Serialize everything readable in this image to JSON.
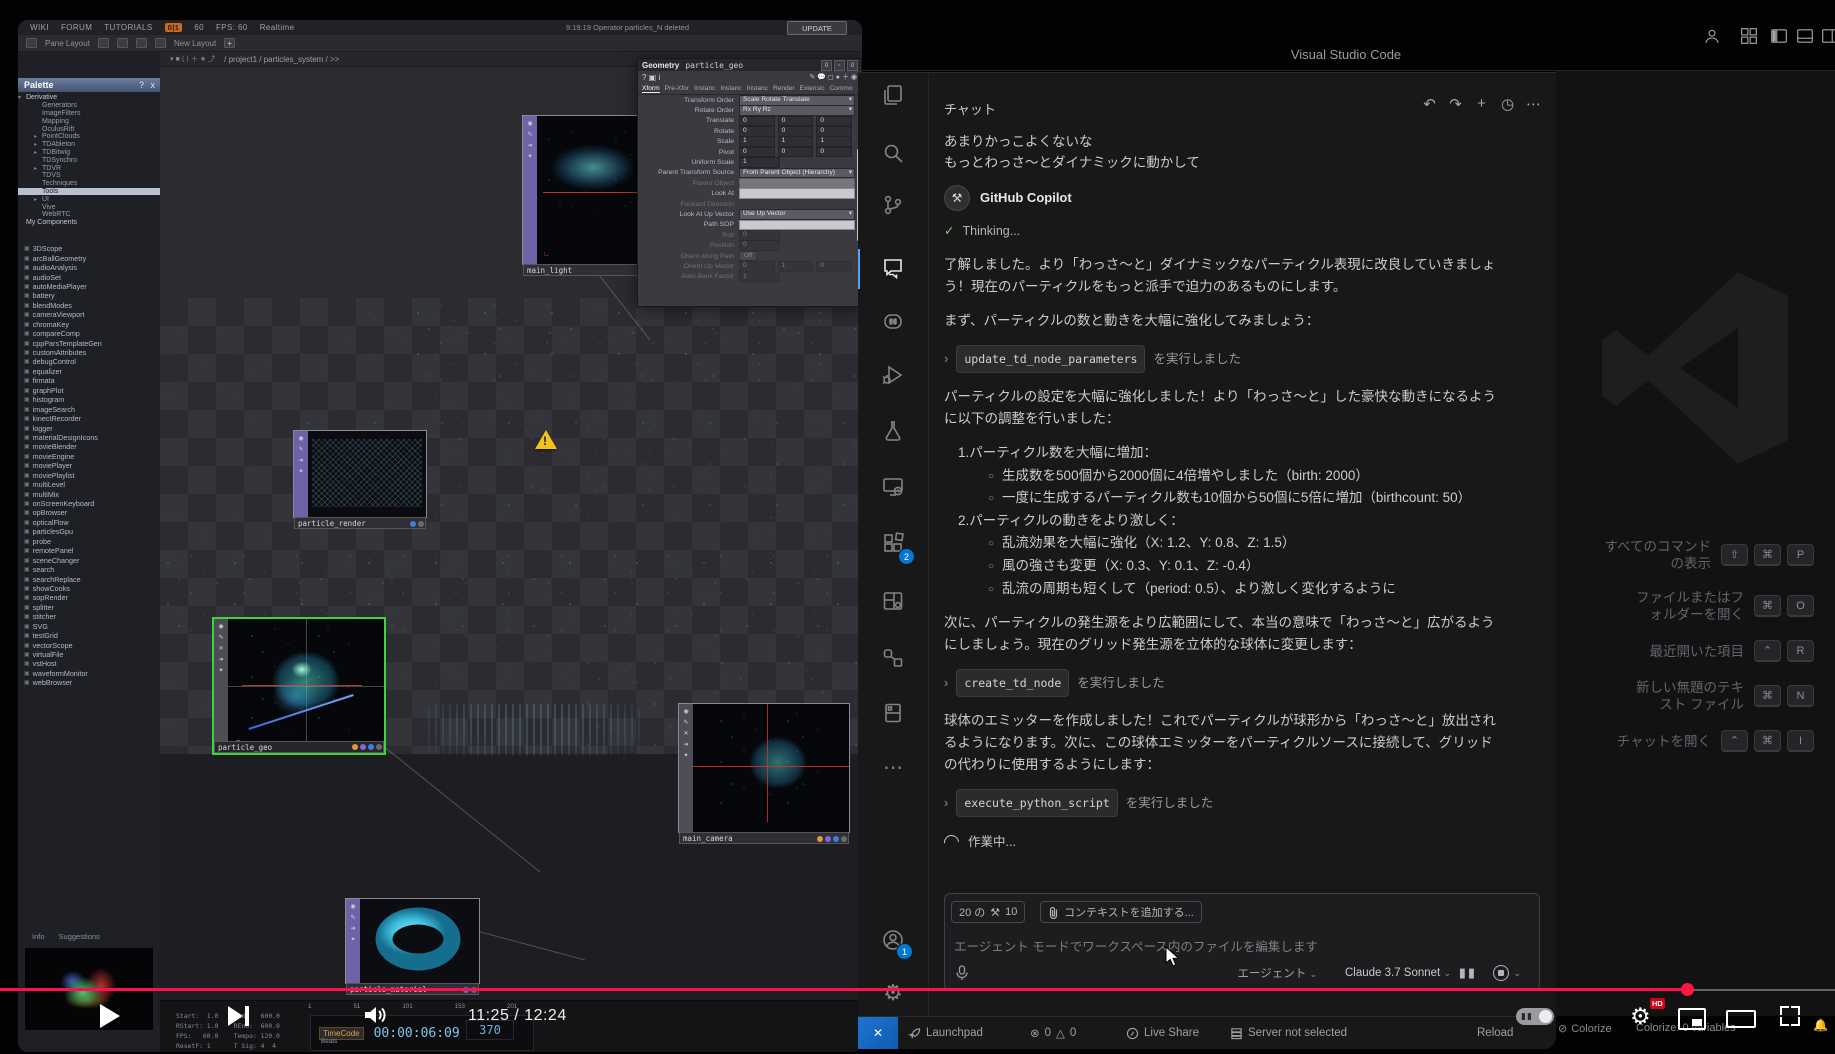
{
  "player": {
    "time": "11:25 / 12:24",
    "hd_badge": "HD",
    "autoplay_glyph": "▮▮"
  },
  "titlebar": {
    "title": "Visual Studio Code"
  },
  "td": {
    "menu": {
      "wiki": "WIKI",
      "forum": "FORUM",
      "tutorials": "TUTORIALS",
      "perf_badge": "0|1",
      "perf_value": "60",
      "fps": "FPS: 60",
      "realtime": "Realtime",
      "toast": "9:19:19 Operator particles_N deleted",
      "update": "UPDATE",
      "pane_layout": "Pane Layout",
      "new_layout": "New Layout",
      "add": "+"
    },
    "pathbar": {
      "path": "/ project1 / particles_system / >>"
    },
    "palette": {
      "title": "Palette",
      "help": "?",
      "close": "x",
      "tree": [
        {
          "a": "▾",
          "t": "Derivative",
          "_cls": "root"
        },
        {
          "a": "",
          "t": "Generators"
        },
        {
          "a": "",
          "t": "ImageFilters"
        },
        {
          "a": "",
          "t": "Mapping"
        },
        {
          "a": "",
          "t": "OculusRift"
        },
        {
          "a": "▸",
          "t": "PointClouds"
        },
        {
          "a": "▸",
          "t": "TDAbleton"
        },
        {
          "a": "▸",
          "t": "TDBitwig"
        },
        {
          "a": "",
          "t": "TDSynchro"
        },
        {
          "a": "▸",
          "t": "TDVR"
        },
        {
          "a": "",
          "t": "TDVS"
        },
        {
          "a": "",
          "t": "Techniques"
        },
        {
          "a": "",
          "t": "Tools",
          "_cls": "sel"
        },
        {
          "a": "▸",
          "t": "UI"
        },
        {
          "a": "",
          "t": "Vive"
        },
        {
          "a": "",
          "t": "WebRTC"
        },
        {
          "a": "",
          "t": "My Components",
          "_cls": "root"
        }
      ],
      "ops": [
        "3DScope",
        "arcBallGeometry",
        "audioAnalysis",
        "audioSet",
        "autoMediaPlayer",
        "battery",
        "blendModes",
        "cameraViewport",
        "chromaKey",
        "compareComp",
        "cppParsTemplateGen",
        "customAttributes",
        "debugControl",
        "equalizer",
        "firmata",
        "graphPlot",
        "histogram",
        "imageSearch",
        "kinectRecorder",
        "logger",
        "materialDesignIcons",
        "movieBlender",
        "movieEngine",
        "moviePlayer",
        "moviePlaylist",
        "multiLevel",
        "multiMix",
        "onScreenKeyboard",
        "opBrowser",
        "opticalFlow",
        "particlesGpu",
        "probe",
        "remotePanel",
        "sceneChanger",
        "search",
        "searchReplace",
        "showCooks",
        "sopRender",
        "splitter",
        "stitcher",
        "SVG",
        "testGrid",
        "vectorScope",
        "virtualFile",
        "vstHost",
        "waveformMonitor",
        "webBrowser"
      ],
      "tabs": {
        "info": "Info",
        "suggestions": "Suggestions"
      }
    },
    "nodes": {
      "main_light": "main_light",
      "particle_render": "particle_render",
      "particle_geo": "particle_geo",
      "main_camera": "main_camera",
      "particle_material": "particle_material"
    },
    "dialog": {
      "type": "Geometry",
      "name": "particle_geo",
      "icons_left": "? ▣ i",
      "tabs": [
        "Xform",
        "Pre-Xfor",
        "Instanc",
        "Instanc",
        "Instanc",
        "Render",
        "Extensic",
        "Commo",
        "»"
      ],
      "rows": [
        {
          "label": "Transform Order",
          "val": "Scale Rotate Translate",
          "kind": "dd"
        },
        {
          "label": "Rotate Order",
          "val": "Rx Ry Rz",
          "kind": "dd"
        },
        {
          "label": "Translate",
          "v1": "0",
          "v2": "0",
          "v3": "0",
          "kind": "cells"
        },
        {
          "label": "Rotate",
          "v1": "0",
          "v2": "0",
          "v3": "0",
          "kind": "cells"
        },
        {
          "label": "Scale",
          "v1": "1",
          "v2": "1",
          "v3": "1",
          "kind": "cells"
        },
        {
          "label": "Pivot",
          "v1": "0",
          "v2": "0",
          "v3": "0",
          "kind": "cells"
        },
        {
          "label": "Uniform Scale",
          "v1": "1",
          "kind": "cells"
        },
        {
          "label": "Parent Transform Source",
          "val": "From Parent Object (Hierarchy)",
          "kind": "dd"
        },
        {
          "label": "Parent Object",
          "kind": "fieldlight",
          "_cls": "dim"
        },
        {
          "label": "Look At",
          "kind": "fieldlight"
        },
        {
          "label": "Forward Direction",
          "kind": "none",
          "_cls": "dim"
        },
        {
          "label": "Look At Up Vector",
          "val": "Use Up Vector",
          "kind": "dd"
        },
        {
          "label": "Path SOP",
          "kind": "fieldlight"
        },
        {
          "label": "Roll",
          "v1": "0",
          "kind": "cells",
          "_cls": "dim"
        },
        {
          "label": "Position",
          "v1": "0",
          "kind": "cells",
          "_cls": "dim"
        },
        {
          "label": "Orient Along Path",
          "val": "Off",
          "kind": "pill",
          "_cls": "dim"
        },
        {
          "label": "Orient Up Vector",
          "v1": "0",
          "v2": "1",
          "v3": "0",
          "kind": "cells",
          "_cls": "dim"
        },
        {
          "label": "Auto-Bank Factor",
          "v1": "1",
          "kind": "cells",
          "_cls": "dim"
        }
      ]
    },
    "timeline": {
      "info_lines": "Start:  1.0    End:   600.0\nRStart: 1.0    REnd:  600.0\nFPS:   60.0    Tempo: 120.0\nResetF: 1      T Sig: 4  4",
      "ruler": [
        "1",
        "51",
        "101",
        "153",
        "201"
      ],
      "timecode_label": "TimeCode",
      "beats_label": "Beats",
      "timecode": "00:00:06:09",
      "frame": "370"
    }
  },
  "vscode": {
    "chat": {
      "header": "チャット",
      "user_messages": [
        "あまりかっこよくないな",
        "もっとわっさ〜とダイナミックに動かして"
      ],
      "assistant_name": "GitHub Copilot",
      "thinking": "Thinking...",
      "p1": "了解しました。より「わっさ〜と」ダイナミックなパーティクル表現に改良していきましょう！現在のパーティクルをもっと派手で迫力のあるものにします。",
      "p2": "まず、パーティクルの数と動きを大幅に強化してみましょう：",
      "tool1": "update_td_node_parameters",
      "tool_suffix": "を実行しました",
      "p3": "パーティクルの設定を大幅に強化しました！より「わっさ〜と」した豪快な動きになるように以下の調整を行いました：",
      "list": [
        {
          "m": "1.",
          "t": "パーティクル数を大幅に増加：",
          "kind": "num"
        },
        {
          "m": "○",
          "t": "生成数を500個から2000個に4倍増やしました（birth: 2000）",
          "kind": "bul"
        },
        {
          "m": "○",
          "t": "一度に生成するパーティクル数も10個から50個に5倍に増加（birthcount: 50）",
          "kind": "bul"
        },
        {
          "m": "2.",
          "t": "パーティクルの動きをより激しく：",
          "kind": "num"
        },
        {
          "m": "○",
          "t": "乱流効果を大幅に強化（X: 1.2、Y: 0.8、Z: 1.5）",
          "kind": "bul"
        },
        {
          "m": "○",
          "t": "風の強さも変更（X: 0.3、Y: 0.1、Z: -0.4）",
          "kind": "bul"
        },
        {
          "m": "○",
          "t": "乱流の周期も短くして（period: 0.5）、より激しく変化するように",
          "kind": "bul"
        }
      ],
      "p4": "次に、パーティクルの発生源をより広範囲にして、本当の意味で「わっさ〜と」広がるようにしましょう。現在のグリッド発生源を立体的な球体に変更します：",
      "tool2": "create_td_node",
      "p5": "球体のエミッターを作成しました！これでパーティクルが球形から「わっさ〜と」放出されるようになります。次に、この球体エミッターをパーティクルソースに接続して、グリッドの代わりに使用するようにします：",
      "tool3": "execute_python_script",
      "working": "作業中...",
      "chevron": "›",
      "check": "✓",
      "actions": {
        "undo": "↶",
        "redo": "↷",
        "new": "+",
        "history": "◷",
        "more": "⋯"
      },
      "input": {
        "tools_prefix": "20 の",
        "tools_icon": "⚒",
        "tools_count": "10",
        "add_context": "コンテキストを追加する...",
        "placeholder": "エージェント モードでワークスペース内のファイルを編集します",
        "mode": "エージェント",
        "model": "Claude 3.7 Sonnet",
        "caret": "⌄",
        "pause": "▮▮"
      }
    },
    "badges": {
      "extensions": "2",
      "account": "1"
    },
    "status": {
      "remote_glyph": "✕",
      "launchpad": "Launchpad",
      "errors": "0",
      "warnings": "0",
      "error_glyph": "⊗",
      "warning_glyph": "△",
      "liveshare": "Live Share",
      "server": "Server not selected",
      "reload": "Reload"
    },
    "back": {
      "shortcuts": [
        {
          "label": "すべてのコマンド\nの表示",
          "keys": [
            "⇧",
            "⌘",
            "P"
          ]
        },
        {
          "label": "ファイルまたはフ\nォルダーを開く",
          "keys": [
            "⌘",
            "O",
            ""
          ]
        },
        {
          "label": "最近開いた項目",
          "keys": [
            "⌃",
            "R",
            ""
          ]
        },
        {
          "label": "新しい無題のテキ\nスト ファイル",
          "keys": [
            "⌘",
            "N",
            ""
          ]
        },
        {
          "label": "チャットを開く",
          "keys": [
            "⌃",
            "⌘",
            "I"
          ]
        }
      ],
      "status_colorize": "Colorize",
      "status_colorize_vars": "Colorize: 0 variables",
      "colorize_glyph": "⊘"
    }
  }
}
